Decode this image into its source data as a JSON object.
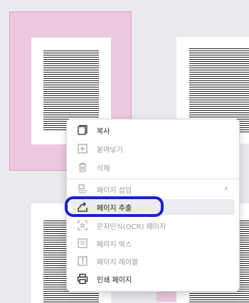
{
  "context_menu": {
    "items": [
      {
        "label": "복사",
        "icon": "copy-icon",
        "enabled": true
      },
      {
        "label": "붙여넣기",
        "icon": "paste-icon",
        "enabled": false
      },
      {
        "label": "삭제",
        "icon": "trash-icon",
        "enabled": false
      },
      {
        "label": "페이지 삽입",
        "icon": "insert-page-icon",
        "enabled": false,
        "has_submenu": true
      },
      {
        "label": "페이지 추출",
        "icon": "extract-page-icon",
        "enabled": true,
        "highlighted": true
      },
      {
        "label": "문자인식(OCR) 페이지",
        "icon": "ocr-icon",
        "enabled": false
      },
      {
        "label": "페이지 박스",
        "icon": "page-box-icon",
        "enabled": false
      },
      {
        "label": "페이지 레이블",
        "icon": "page-label-icon",
        "enabled": false
      },
      {
        "label": "인쇄 페이지",
        "icon": "print-icon",
        "enabled": true
      }
    ]
  },
  "colors": {
    "selection_fill": "#ecc8dd",
    "selection_border": "#e59ac7",
    "focus_ring": "#1b1fd4"
  }
}
